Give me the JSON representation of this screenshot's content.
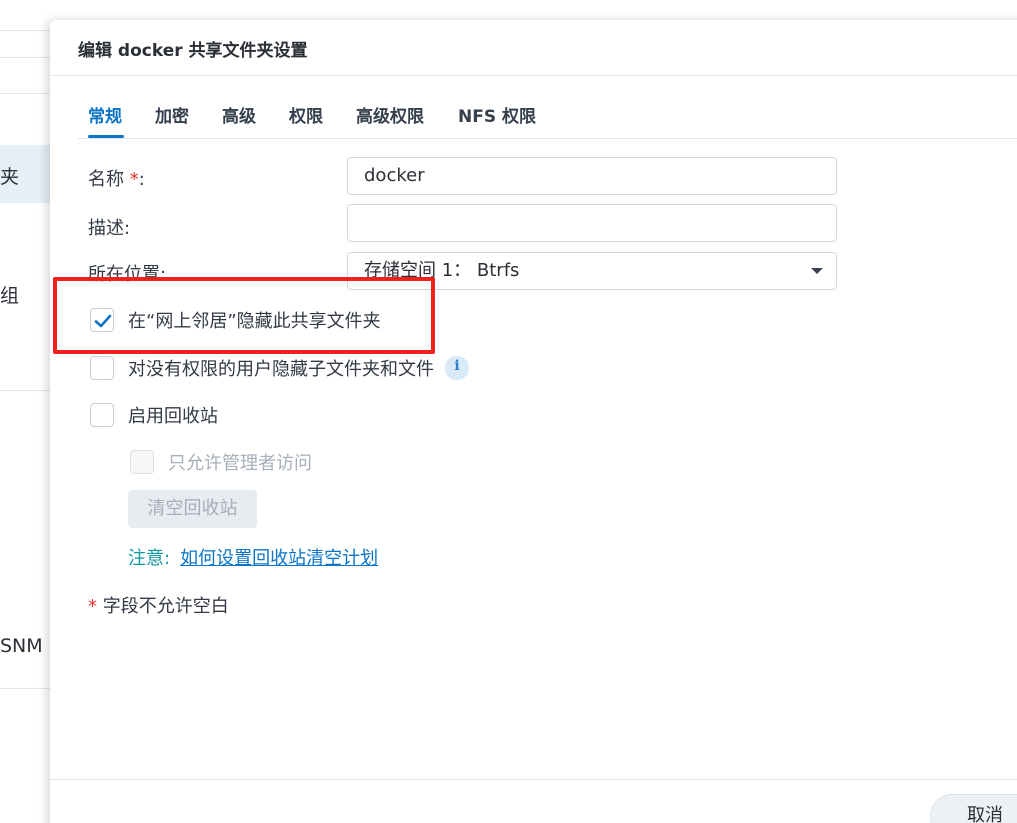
{
  "background_window": {
    "items": [
      {
        "label": "夹"
      },
      {
        "label": "组"
      },
      {
        "label": "SNM"
      }
    ]
  },
  "dialog": {
    "title": "编辑 docker 共享文件夹设置",
    "tabs": [
      {
        "label": "常规",
        "active": true
      },
      {
        "label": "加密",
        "active": false
      },
      {
        "label": "高级",
        "active": false
      },
      {
        "label": "权限",
        "active": false
      },
      {
        "label": "高级权限",
        "active": false
      },
      {
        "label": "NFS 权限",
        "active": false
      }
    ],
    "form": {
      "name_label": "名称",
      "required_mark": "*",
      "name_colon": ":",
      "name_value": "docker",
      "description_label": "描述:",
      "description_value": "",
      "location_label": "所在位置:",
      "location_value": "存储空间 1： Btrfs"
    },
    "checkboxes": [
      {
        "label": "在“网上邻居”隐藏此共享文件夹",
        "checked": true,
        "disabled": false
      },
      {
        "label": "对没有权限的用户隐藏子文件夹和文件",
        "checked": false,
        "disabled": false
      },
      {
        "label": "启用回收站",
        "checked": false,
        "disabled": false
      },
      {
        "label": "只允许管理者访问",
        "checked": false,
        "disabled": true
      }
    ],
    "empty_recycle_button": "清空回收站",
    "note_label": "注意:",
    "note_link": "如何设置回收站清空计划",
    "footnote_mark": "*",
    "footnote_text": " 字段不允许空白",
    "cancel_button": "取消",
    "info_icon_glyph": "i"
  },
  "colors": {
    "accent": "#0b74c7",
    "required": "#e0302a",
    "note": "#0e9aa0",
    "highlight_box": "#f0201a"
  }
}
